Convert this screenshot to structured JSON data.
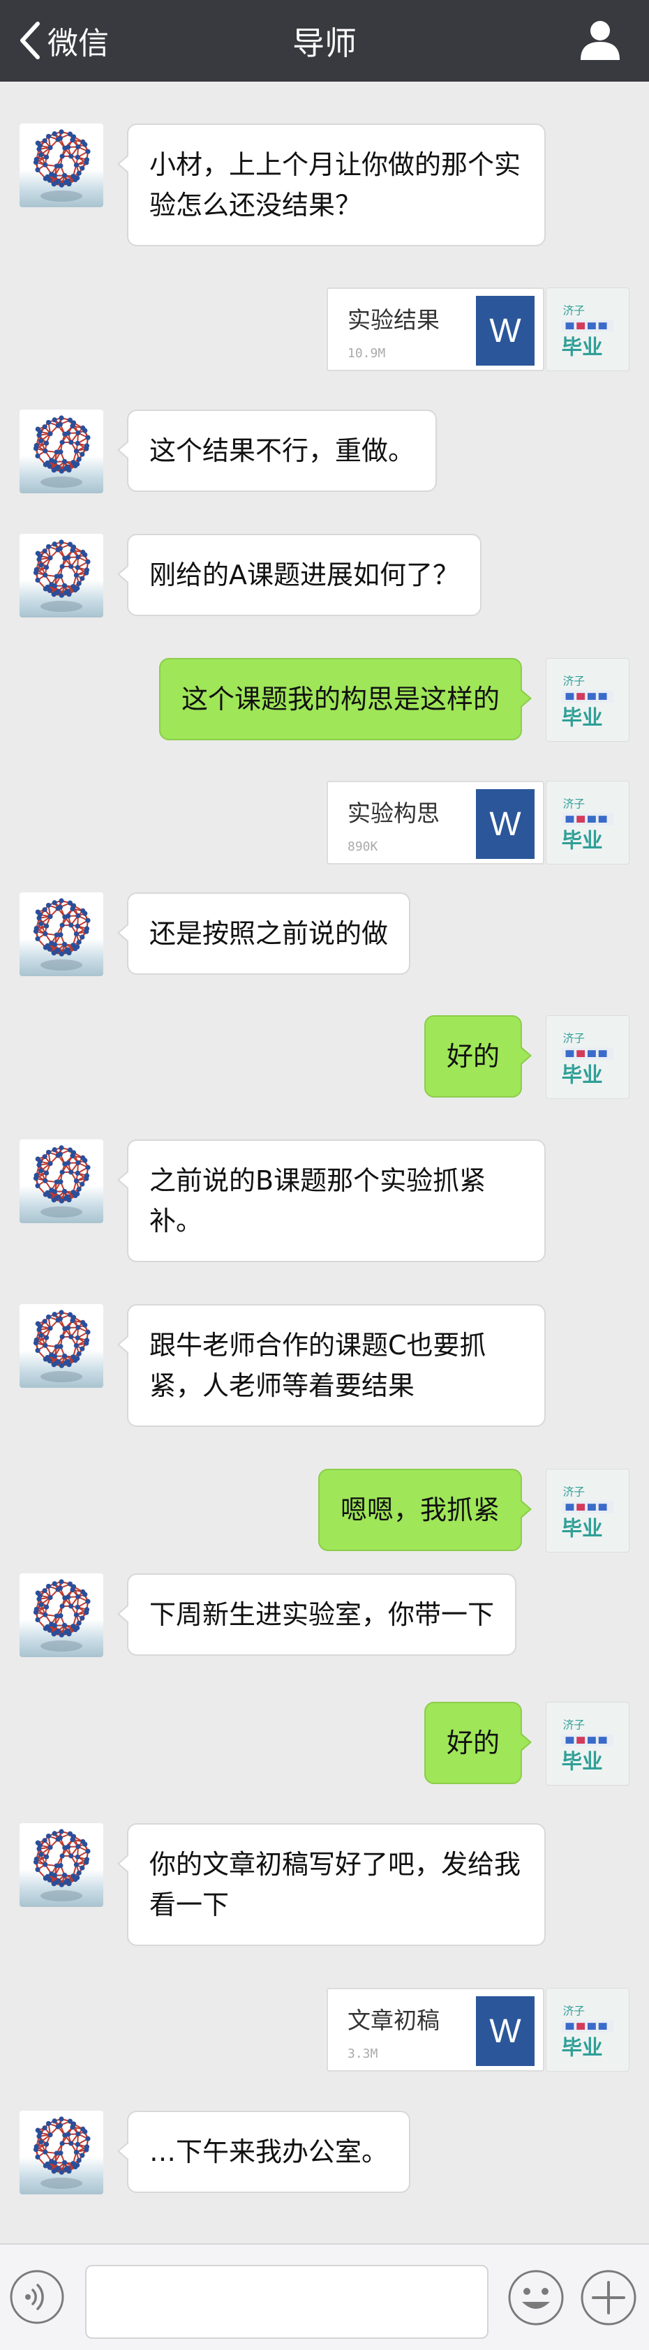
{
  "header": {
    "back_label": "微信",
    "title": "导师",
    "back_icon": "chevron-left-icon",
    "user_icon": "person-icon"
  },
  "avatars": {
    "teacher": "buckyball-molecule",
    "me": "graduation-logo",
    "me_caption": "毕业",
    "me_small": "济子"
  },
  "messages": [
    {
      "side": "left",
      "type": "text",
      "text": "小材，上上个月让你做的那个实验怎么还没结果？"
    },
    {
      "side": "right",
      "type": "file",
      "name": "实验结果",
      "size": "10.9M",
      "icon": "W"
    },
    {
      "side": "left",
      "type": "text",
      "text": "这个结果不行，重做。"
    },
    {
      "side": "left",
      "type": "text",
      "text": "刚给的A课题进展如何了？"
    },
    {
      "side": "right",
      "type": "text",
      "text": "这个课题我的构思是这样的"
    },
    {
      "side": "right",
      "type": "file",
      "name": "实验构思",
      "size": "890K",
      "icon": "W"
    },
    {
      "side": "left",
      "type": "text",
      "text": "还是按照之前说的做"
    },
    {
      "side": "right",
      "type": "text",
      "text": "好的"
    },
    {
      "side": "left",
      "type": "text",
      "text": "之前说的B课题那个实验抓紧补。"
    },
    {
      "side": "left",
      "type": "text",
      "text": "跟牛老师合作的课题C也要抓紧，人老师等着要结果"
    },
    {
      "side": "right",
      "type": "text",
      "text": "嗯嗯，我抓紧"
    },
    {
      "side": "left",
      "type": "text",
      "text": "下周新生进实验室，你带一下"
    },
    {
      "side": "right",
      "type": "text",
      "text": "好的"
    },
    {
      "side": "left",
      "type": "text",
      "text": "你的文章初稿写好了吧，发给我看一下"
    },
    {
      "side": "right",
      "type": "file",
      "name": "文章初稿",
      "size": "3.3M",
      "icon": "W"
    },
    {
      "side": "left",
      "type": "text",
      "text": "…下午来我办公室。"
    }
  ],
  "input_bar": {
    "voice_icon": "voice-icon",
    "input_value": "",
    "emoji_icon": "emoji-icon",
    "plus_icon": "plus-icon"
  },
  "colors": {
    "header_bg": "#393a3f",
    "chat_bg": "#ebebeb",
    "sent_bubble": "#9fe658",
    "received_bubble": "#ffffff",
    "word_icon": "#2b579a"
  }
}
